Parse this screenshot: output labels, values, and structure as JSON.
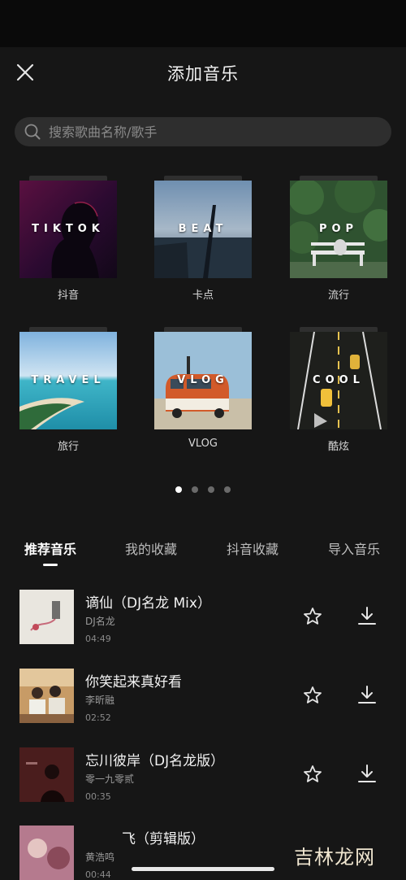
{
  "header": {
    "title": "添加音乐"
  },
  "search": {
    "placeholder": "搜索歌曲名称/歌手"
  },
  "categories": [
    {
      "label": "抖音",
      "thumb_text": "TIKTOK",
      "icon": "silhouette-image"
    },
    {
      "label": "卡点",
      "thumb_text": "BEAT",
      "icon": "car-window-image"
    },
    {
      "label": "流行",
      "thumb_text": "POP",
      "icon": "bench-image"
    },
    {
      "label": "旅行",
      "thumb_text": "TRAVEL",
      "icon": "beach-image"
    },
    {
      "label": "VLOG",
      "thumb_text": "VLOG",
      "icon": "van-image"
    },
    {
      "label": "酷炫",
      "thumb_text": "COOL",
      "icon": "road-image"
    }
  ],
  "pager": {
    "pages": 4,
    "active": 1
  },
  "tabs": [
    {
      "label": "推荐音乐",
      "active": true
    },
    {
      "label": "我的收藏",
      "active": false
    },
    {
      "label": "抖音收藏",
      "active": false
    },
    {
      "label": "导入音乐",
      "active": false
    }
  ],
  "songs": [
    {
      "title": "谪仙（DJ名龙 Mix）",
      "artist": "DJ名龙",
      "duration": "04:49"
    },
    {
      "title": "你笑起来真好看",
      "artist": "李昕融",
      "duration": "02:52"
    },
    {
      "title": "忘川彼岸（DJ名龙版）",
      "artist": "零一九零贰",
      "duration": "00:35"
    },
    {
      "title": "飞（剪辑版）",
      "artist": "黄浩鸣",
      "duration": "00:44"
    }
  ],
  "watermark": {
    "text": "吉林龙网"
  },
  "colors": {
    "background": "#161616",
    "search_bg": "#2e2e2e",
    "text": "#ffffff",
    "muted": "#9a9a9a"
  }
}
